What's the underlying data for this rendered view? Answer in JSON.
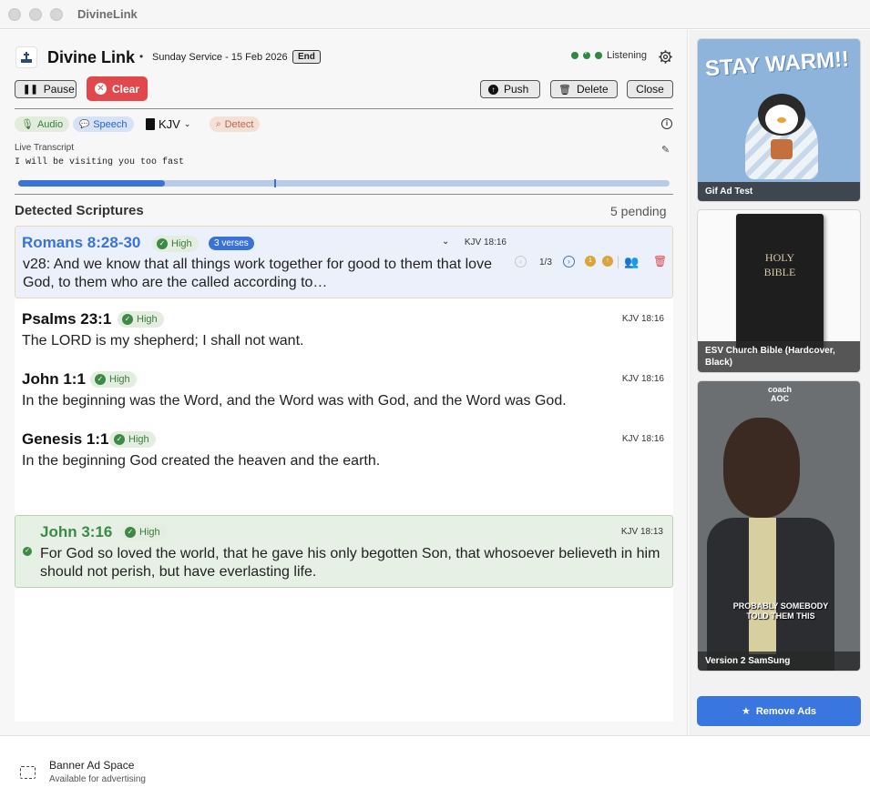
{
  "window": {
    "title": "DivineLink"
  },
  "header": {
    "app_name": "Divine Link",
    "separator": "•",
    "service": "Sunday Service - 15 Feb 2026",
    "end_label": "End",
    "status": "Listening"
  },
  "toolbar": {
    "pause": "Pause",
    "clear": "Clear",
    "push": "Push",
    "delete": "Delete",
    "close": "Close"
  },
  "chips": {
    "audio": "Audio",
    "speech": "Speech",
    "translation": "KJV",
    "detect": "Detect"
  },
  "transcript": {
    "label": "Live Transcript",
    "text": "I will be visiting you too fast",
    "progress": 0.225
  },
  "detected": {
    "title": "Detected Scriptures",
    "pending": "5 pending",
    "items": [
      {
        "ref": "Romans 8:28-30",
        "confidence": "High",
        "badge": "3 verses",
        "meta": "KJV 18:16",
        "pager": "1/3",
        "text": "v28: And we know that all things work together for good to them that love God, to them who are the called according to…"
      },
      {
        "ref": "Psalms 23:1",
        "confidence": "High",
        "meta": "KJV 18:16",
        "text": "The LORD is my shepherd; I shall not want."
      },
      {
        "ref": "John 1:1",
        "confidence": "High",
        "meta": "KJV 18:16",
        "text": "In the beginning was the Word, and the Word was with God, and the Word was God."
      },
      {
        "ref": "Genesis 1:1",
        "confidence": "High",
        "meta": "KJV 18:16",
        "text": "In the beginning God created the heaven and the earth."
      },
      {
        "ref": "John 3:16",
        "confidence": "High",
        "meta": "KJV 18:13",
        "text": "For God so loved the world, that he gave his only begotten Son, that whosoever believeth in him should not perish, but have everlasting life."
      }
    ]
  },
  "ads": [
    {
      "caption": "Gif Ad Test",
      "art_text": "STAY WARM!!"
    },
    {
      "caption": "ESV Church Bible (Hardcover, Black)",
      "art_text": "HOLY BIBLE"
    },
    {
      "caption": "Version 2 SamSung",
      "art_text": "PROBABLY SOMEBODY TOLD THEM THIS",
      "art_brand": "coach AOC"
    }
  ],
  "remove_ads": "Remove Ads",
  "banner": {
    "title": "Banner Ad Space",
    "subtitle": "Available for advertising"
  },
  "colors": {
    "accent": "#3a73d6",
    "clear": "#e0484b",
    "success": "#2f8a3f"
  }
}
